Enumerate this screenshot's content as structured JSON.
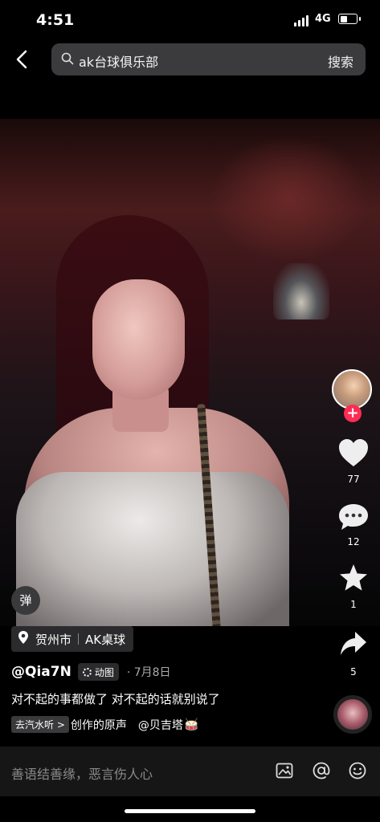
{
  "status_bar": {
    "time": "4:51",
    "network": "4G"
  },
  "search": {
    "query": "ak台球俱乐部",
    "button_label": "搜索"
  },
  "actions": {
    "likes": "77",
    "comments": "12",
    "favorites": "1",
    "shares": "5",
    "follow_symbol": "+"
  },
  "danmaku_label": "弹",
  "location": {
    "city": "贺州市",
    "place": "AK桌球"
  },
  "post": {
    "username": "@Qia7N",
    "badge_label": "动图",
    "date": "· 7月8日",
    "caption": "对不起的事都做了 对不起的话就别说了"
  },
  "music": {
    "button_label": "去汽水听 >",
    "text": "创作的原声",
    "mention": "@贝吉塔",
    "emoji": "🥁"
  },
  "comment_bar": {
    "placeholder": "善语结善缘，恶言伤人心"
  }
}
